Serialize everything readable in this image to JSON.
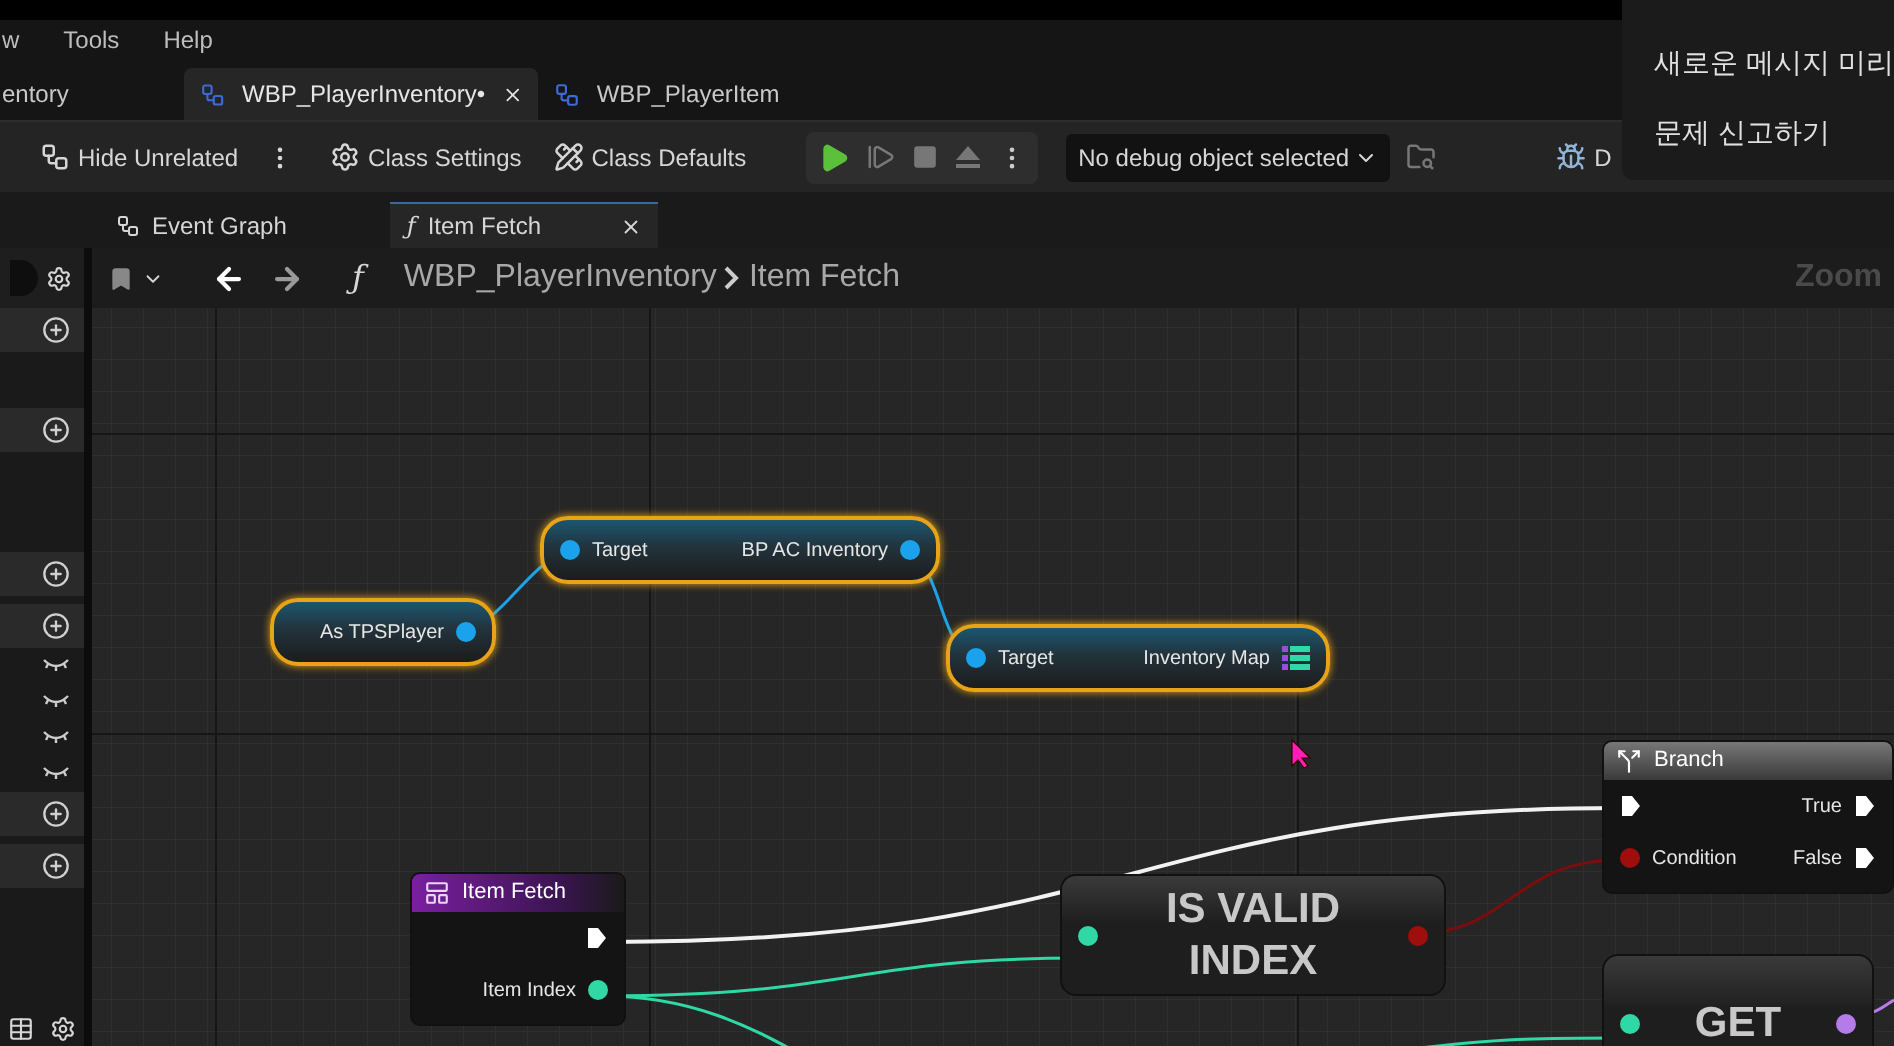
{
  "menu": [
    "w",
    "Tools",
    "Help"
  ],
  "doc_tabs": [
    {
      "label": "entory",
      "selected": false,
      "closable": false
    },
    {
      "label": "WBP_PlayerInventory•",
      "selected": true,
      "closable": true
    },
    {
      "label": "WBP_PlayerItem",
      "selected": false,
      "closable": false
    }
  ],
  "toolbar": [
    {
      "kind": "hide",
      "label": "Hide Unrelated"
    },
    {
      "kind": "more"
    },
    {
      "kind": "settings",
      "label": "Class Settings"
    },
    {
      "kind": "defaults",
      "label": "Class Defaults"
    }
  ],
  "debug_dropdown": {
    "value": "No debug object selected"
  },
  "debug_button": {
    "label": "D"
  },
  "popup_menu": [
    "새로운 메시지 미리",
    "문제 신고하기"
  ],
  "graph_tabs": [
    {
      "label": "Event Graph",
      "selected": false,
      "closable": false
    },
    {
      "icon": "ƒ",
      "label": "Item Fetch",
      "selected": true,
      "closable": true
    }
  ],
  "breadcrumb": {
    "icon": "ƒ",
    "path": [
      "WBP_PlayerInventory",
      "Item Fetch"
    ]
  },
  "zoom_label": "Zoom",
  "sidebar": {
    "rows": [
      {
        "kind": "add"
      },
      {
        "kind": "add"
      },
      {
        "kind": "add"
      },
      {
        "kind": "add"
      },
      {
        "kind": "hidden"
      },
      {
        "kind": "hidden"
      },
      {
        "kind": "hidden"
      },
      {
        "kind": "hidden"
      },
      {
        "kind": "add"
      },
      {
        "kind": "add"
      }
    ]
  },
  "nodes": [
    {
      "kind": "getter",
      "selected": true,
      "outputs": [
        {
          "label": "As TPSPlayer",
          "kind": "object"
        }
      ]
    },
    {
      "kind": "getter",
      "selected": true,
      "inputs": [
        {
          "label": "Target",
          "kind": "object"
        }
      ],
      "outputs": [
        {
          "label": "BP AC Inventory",
          "kind": "object"
        }
      ]
    },
    {
      "kind": "getter",
      "selected": true,
      "inputs": [
        {
          "label": "Target",
          "kind": "object"
        }
      ],
      "outputs": [
        {
          "label": "Inventory Map",
          "kind": "map"
        }
      ]
    },
    {
      "kind": "entry",
      "title": "Item Fetch",
      "selected": false,
      "outputs": [
        {
          "kind": "exec"
        },
        {
          "label": "Item Index",
          "kind": "int"
        }
      ]
    },
    {
      "kind": "compact",
      "title": "IS VALID INDEX",
      "selected": false,
      "inputs": [
        {
          "kind": "int"
        }
      ],
      "outputs": [
        {
          "kind": "bool"
        }
      ]
    },
    {
      "kind": "branch",
      "title": "Branch",
      "selected": false,
      "inputs": [
        {
          "kind": "exec"
        },
        {
          "label": "Condition",
          "kind": "bool"
        }
      ],
      "outputs": [
        {
          "label": "True",
          "kind": "exec"
        },
        {
          "label": "False",
          "kind": "exec"
        }
      ]
    },
    {
      "kind": "compact",
      "title": "GET",
      "selected": false,
      "inputs": [
        {
          "kind": "int"
        }
      ],
      "outputs": [
        {
          "kind": "wild"
        }
      ]
    }
  ]
}
